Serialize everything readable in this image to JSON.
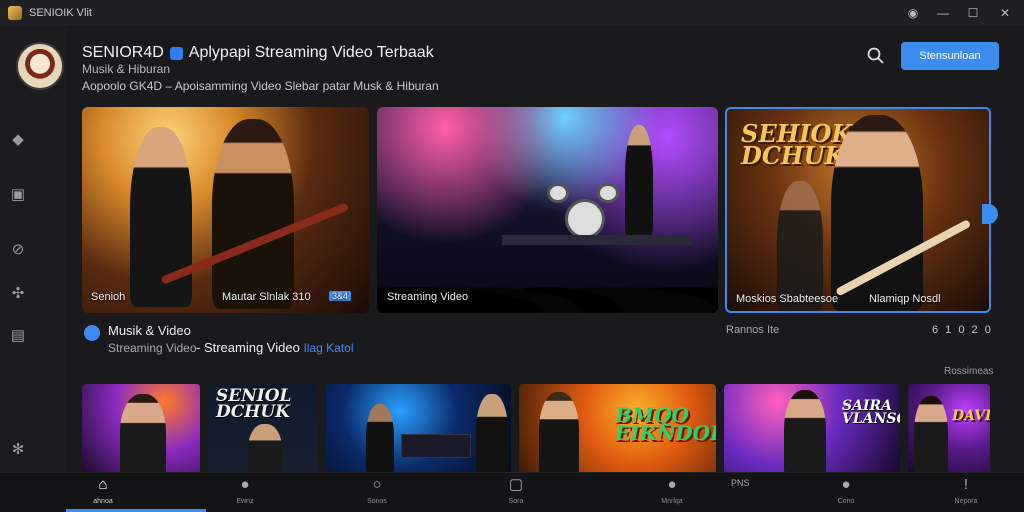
{
  "window": {
    "title": "SENIOIK Vlit",
    "controls": [
      "◉",
      "—",
      "☐",
      "✕"
    ]
  },
  "header": {
    "title": "SENIOR4D",
    "title_tail": "Aplypapi Streaming Video Terbaak",
    "subtitle": "Musik & Hiburan",
    "tagline": "Aopoolo GK4D – Apoisamming Video Slebar patar Musk & Hiburan",
    "primary_button": "Stensunloan"
  },
  "heroes": [
    {
      "label": "Senioh",
      "label2": "Mautar Slnlak 310",
      "tag": "3&4"
    },
    {
      "label": "Streaming Video"
    },
    {
      "label": "Moskios Sbabteesoe",
      "label2": "Nlamiqp Nosdl",
      "overlay_text": "SEHIOK DCHUK"
    }
  ],
  "section": {
    "title": "Musik & Video",
    "subtitle": "Streaming Video",
    "subtitle2": "- Streaming Video",
    "link": "Ilag Katol",
    "right_label": "Rannos Ite",
    "right_counter": "6 1 0  2 0",
    "right_more": "Rossimeas"
  },
  "thumbs": [
    {
      "overlay_text": ""
    },
    {
      "overlay_text": "SENIOL DCHUK"
    },
    {
      "overlay_text": ""
    },
    {
      "overlay_text": ""
    },
    {
      "overlay_text": "BMQO EIKNDOR"
    },
    {
      "overlay_text": "SAIRA VLANSOUR"
    },
    {
      "overlay_text": "DAVI"
    }
  ],
  "bottom_nav": [
    {
      "icon": "home-icon",
      "glyph": "⌂",
      "label": "ahnoa"
    },
    {
      "icon": "person-icon",
      "glyph": "●",
      "label": "Ewnz"
    },
    {
      "icon": "search-icon",
      "glyph": "○",
      "label": "Sonos"
    },
    {
      "icon": "square-icon",
      "glyph": "▢",
      "label": "Sora"
    },
    {
      "icon": "profile-icon",
      "glyph": "●",
      "label": "Mnrlqa"
    },
    {
      "icon": "user-icon",
      "glyph": "●",
      "label": "Cono"
    },
    {
      "icon": "alert-icon",
      "glyph": "!",
      "label": "Nepora"
    }
  ],
  "bottom_misc": "PNS",
  "colors": {
    "accent": "#3c8cf0",
    "background": "#1a1a1d"
  }
}
